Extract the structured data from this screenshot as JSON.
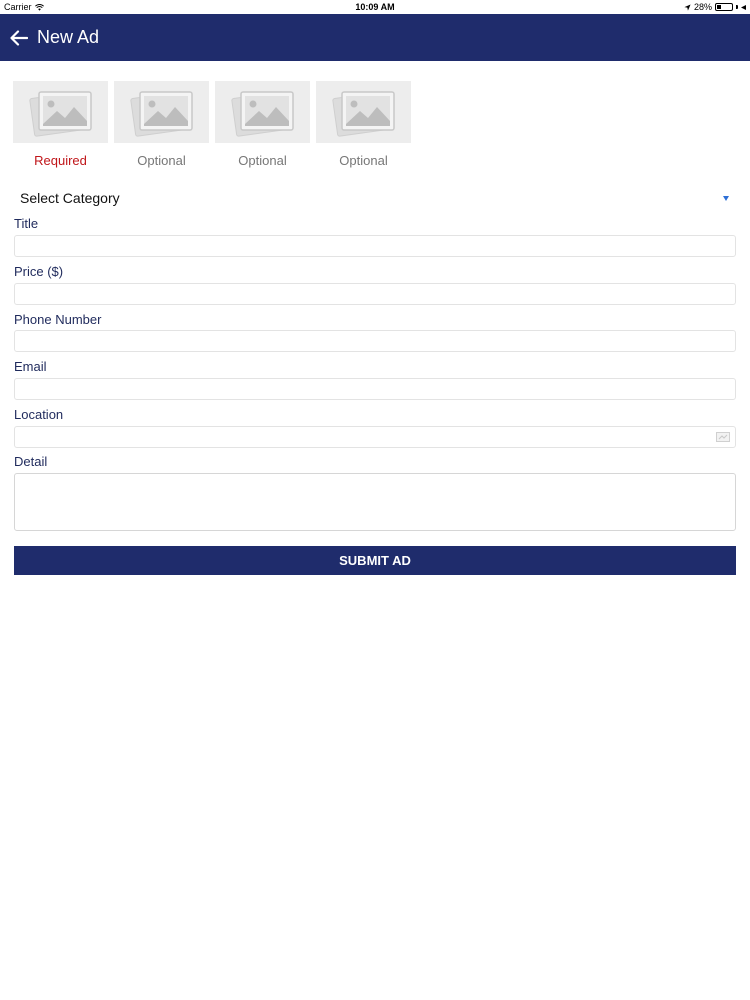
{
  "status_bar": {
    "carrier": "Carrier",
    "time": "10:09 AM",
    "battery_text": "28%",
    "battery_level": 0.28
  },
  "header": {
    "title": "New Ad",
    "back_icon": "arrow-left-icon",
    "background_color": "#1f2c6c"
  },
  "photos": [
    {
      "label": "Required",
      "icon": "image-placeholder-icon"
    },
    {
      "label": "Optional",
      "icon": "image-placeholder-icon"
    },
    {
      "label": "Optional",
      "icon": "image-placeholder-icon"
    },
    {
      "label": "Optional",
      "icon": "image-placeholder-icon"
    }
  ],
  "category": {
    "selected": "Select Category"
  },
  "form": {
    "title_label": "Title",
    "title_value": "",
    "price_label": "Price ($)",
    "price_value": "",
    "phone_label": "Phone Number",
    "phone_value": "",
    "email_label": "Email",
    "email_value": "",
    "location_label": "Location",
    "location_value": "",
    "detail_label": "Detail",
    "detail_value": ""
  },
  "submit": {
    "label": "SUBMIT AD"
  },
  "colors": {
    "primary": "#1f2c6c",
    "required": "#c0161a",
    "optional": "#777777"
  }
}
